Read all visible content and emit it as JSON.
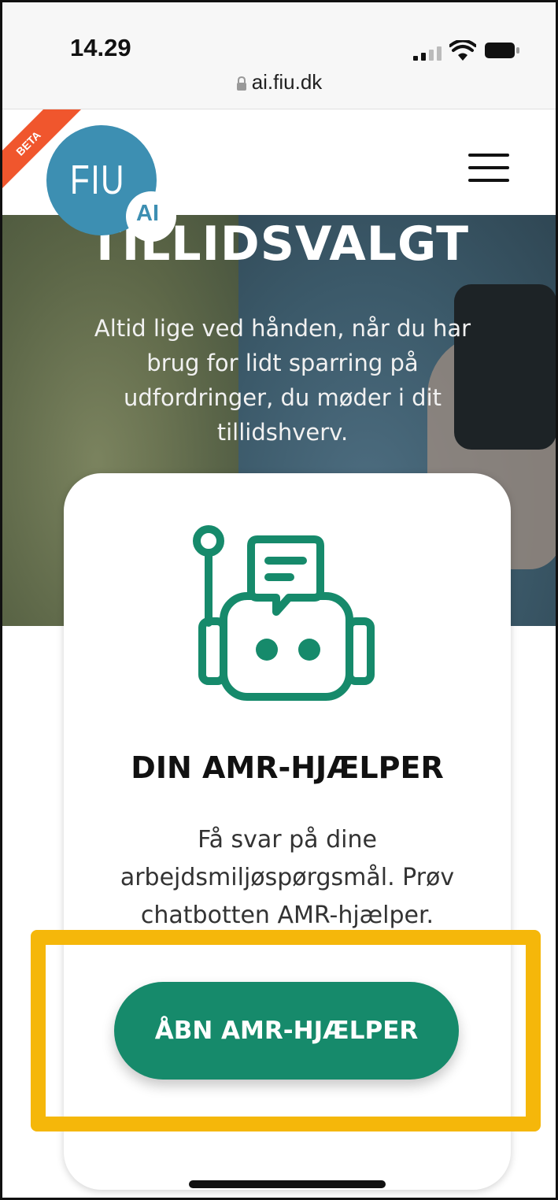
{
  "status_bar": {
    "time": "14.29",
    "url": "ai.fiu.dk"
  },
  "header": {
    "logo_text": "FIU",
    "ai_badge": "AI",
    "beta_ribbon": "BETA"
  },
  "hero": {
    "title": "TILLIDSVALGT",
    "text": "Altid lige ved hånden, når du har brug for lidt sparring på udfordringer, du møder i dit tillidshverv."
  },
  "card": {
    "title": "DIN AMR-HJÆLPER",
    "text": "Få svar på dine arbejdsmiljøspørgsmål. Prøv chatbotten AMR-hjælper.",
    "button_label": "ÅBN AMR-HJÆLPER"
  },
  "colors": {
    "brand_blue": "#3d8fb2",
    "beta_orange": "#f0562d",
    "button_green": "#168a6b",
    "highlight_yellow": "#f5b70a"
  },
  "icons": {
    "lock": "lock-icon",
    "menu": "hamburger-menu-icon",
    "bot": "chatbot-robot-icon"
  }
}
